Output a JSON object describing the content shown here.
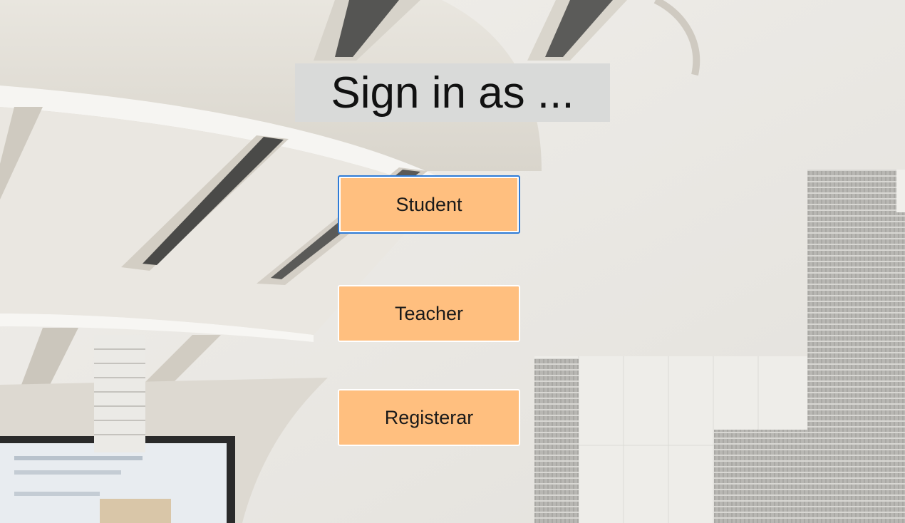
{
  "window": {
    "title": "Sign in as ..."
  },
  "buttons": {
    "student_label": "Student",
    "teacher_label": "Teacher",
    "register_label": "Registerar"
  },
  "colors": {
    "button_fill": "#ffbf7f",
    "focus_border": "#2e7bd6",
    "title_background": "#d9dad9"
  }
}
